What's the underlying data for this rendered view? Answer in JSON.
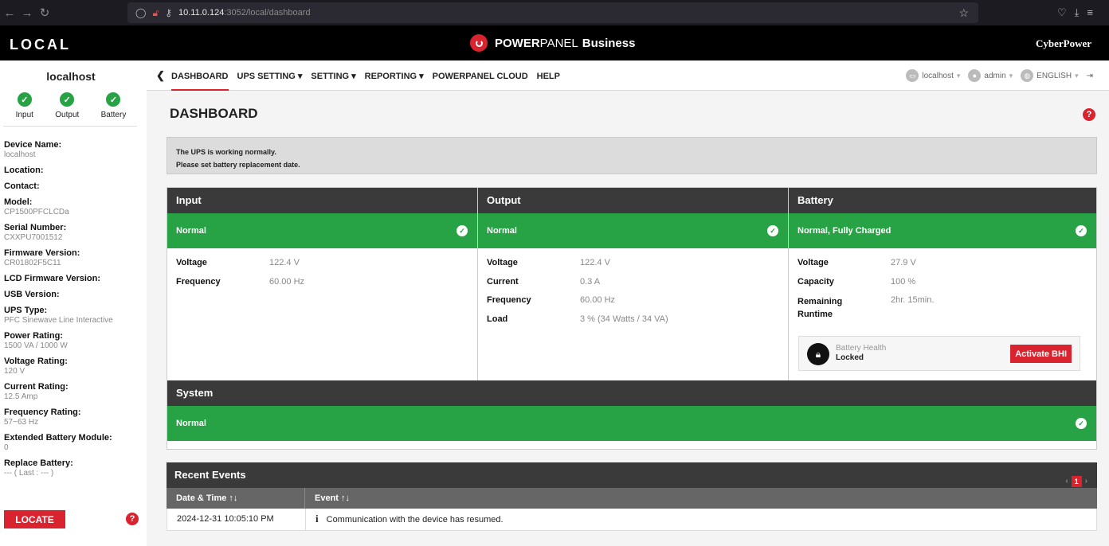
{
  "browser": {
    "url_host": "10.11.0.124",
    "url_rest": ":3052/local/dashboard"
  },
  "header": {
    "left": "LOCAL",
    "brand_power": "POWER",
    "brand_panel": "PANEL",
    "brand_business": "Business",
    "right": "CyberPower"
  },
  "sidebar": {
    "host": "localhost",
    "status": [
      "Input",
      "Output",
      "Battery"
    ],
    "fields": [
      {
        "label": "Device Name:",
        "value": "localhost"
      },
      {
        "label": "Location:",
        "value": ""
      },
      {
        "label": "Contact:",
        "value": ""
      },
      {
        "label": "Model:",
        "value": "CP1500PFCLCDa"
      },
      {
        "label": "Serial Number:",
        "value": "CXXPU7001512"
      },
      {
        "label": "Firmware Version:",
        "value": "CR01802F5C11"
      },
      {
        "label": "LCD Firmware Version:",
        "value": ""
      },
      {
        "label": "USB Version:",
        "value": ""
      },
      {
        "label": "UPS Type:",
        "value": "PFC Sinewave Line Interactive"
      },
      {
        "label": "Power Rating:",
        "value": "1500 VA / 1000 W"
      },
      {
        "label": "Voltage Rating:",
        "value": "120 V"
      },
      {
        "label": "Current Rating:",
        "value": "12.5 Amp"
      },
      {
        "label": "Frequency Rating:",
        "value": "57~63 Hz"
      },
      {
        "label": "Extended Battery Module:",
        "value": "0"
      },
      {
        "label": "Replace Battery:",
        "value": "--- ( Last : --- )"
      }
    ],
    "locate": "LOCATE"
  },
  "nav": {
    "items": [
      "DASHBOARD",
      "UPS SETTING",
      "SETTING",
      "REPORTING",
      "POWERPANEL CLOUD",
      "HELP"
    ],
    "host": "localhost",
    "user": "admin",
    "lang": "ENGLISH"
  },
  "page": {
    "title": "DASHBOARD",
    "alert_1": "The UPS is working normally.",
    "alert_2": "Please set battery replacement date."
  },
  "input": {
    "title": "Input",
    "status": "Normal",
    "rows": [
      {
        "k": "Voltage",
        "v": "122.4 V"
      },
      {
        "k": "Frequency",
        "v": "60.00 Hz"
      }
    ]
  },
  "output": {
    "title": "Output",
    "status": "Normal",
    "rows": [
      {
        "k": "Voltage",
        "v": "122.4 V"
      },
      {
        "k": "Current",
        "v": "0.3 A"
      },
      {
        "k": "Frequency",
        "v": "60.00 Hz"
      },
      {
        "k": "Load",
        "v": "3 % (34 Watts / 34 VA)"
      }
    ]
  },
  "battery": {
    "title": "Battery",
    "status": "Normal, Fully Charged",
    "rows": [
      {
        "k": "Voltage",
        "v": "27.9 V"
      },
      {
        "k": "Capacity",
        "v": "100 %"
      },
      {
        "k": "Remaining Runtime",
        "v": "2hr. 15min."
      }
    ],
    "bhi_title": "Battery Health",
    "bhi_value": "Locked",
    "bhi_button": "Activate BHI"
  },
  "system": {
    "title": "System",
    "status": "Normal"
  },
  "events": {
    "title": "Recent Events",
    "page": "1",
    "col_date": "Date & Time ↑↓",
    "col_event": "Event ↑↓",
    "rows": [
      {
        "date": "2024-12-31 10:05:10 PM",
        "event": "Communication with the device has resumed."
      }
    ]
  },
  "colors": {
    "accent": "#d9232e",
    "ok": "#27a244",
    "panel_header": "#3a3a3a"
  }
}
